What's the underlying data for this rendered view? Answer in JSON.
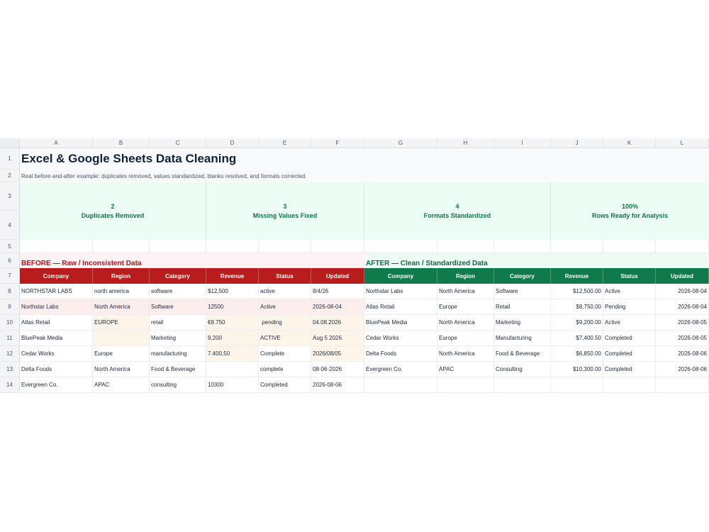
{
  "columns": [
    "A",
    "B",
    "C",
    "D",
    "E",
    "F",
    "G",
    "H",
    "I",
    "J",
    "K",
    "L"
  ],
  "row_numbers": [
    "1",
    "2",
    "3",
    "4",
    "5",
    "6",
    "7",
    "8",
    "9",
    "10",
    "11",
    "12",
    "13",
    "14"
  ],
  "title": "Excel & Google Sheets Data Cleaning",
  "subtitle": "Real before-and-after example: duplicates removed, values standardized, blanks resolved, and formats corrected.",
  "metrics": [
    {
      "value": "2",
      "label": "Duplicates Removed"
    },
    {
      "value": "3",
      "label": "Missing Values Fixed"
    },
    {
      "value": "4",
      "label": "Formats Standardized"
    },
    {
      "value": "100%",
      "label": "Rows Ready for Analysis"
    }
  ],
  "before": {
    "label": "BEFORE — Raw / Inconsistent Data",
    "headers": [
      "Company",
      "Region",
      "Category",
      "Revenue",
      "Status",
      "Updated"
    ],
    "rows": [
      [
        "NORTHSTAR LABS",
        "north america",
        "software",
        "$12,500",
        "active",
        "8/4/26"
      ],
      [
        "Northstar Labs",
        "North America",
        "Software",
        "12500",
        "Active",
        "2026-08-04"
      ],
      [
        "Atlas Retail",
        "EUROPE",
        "retail",
        "€8.750",
        " pending",
        "04.08.2026"
      ],
      [
        "BluePeak Media",
        "",
        "Marketing",
        "9,200",
        "ACTIVE",
        "Aug 5 2026"
      ],
      [
        "Cedar Works",
        "Europe",
        "manufacturing",
        "7.400,50",
        "Complete",
        "2026/08/05"
      ],
      [
        "Delta Foods",
        "North America",
        "Food & Beverage",
        "",
        "complete",
        "08-06-2026"
      ],
      [
        "Evergreen Co.",
        "APAC",
        "consulting",
        "10300",
        "Completed",
        "2026-08-06"
      ]
    ]
  },
  "after": {
    "label": "AFTER — Clean / Standardized Data",
    "headers": [
      "Company",
      "Region",
      "Category",
      "Revenue",
      "Status",
      "Updated"
    ],
    "rows": [
      [
        "Northstar Labs",
        "North America",
        "Software",
        "$12,500.00",
        "Active",
        "2026-08-04"
      ],
      [
        "Atlas Retail",
        "Europe",
        "Retail",
        "$8,750.00",
        "Pending",
        "2026-08-04"
      ],
      [
        "BluePeak Media",
        "North America",
        "Marketing",
        "$9,200.00",
        "Active",
        "2026-08-05"
      ],
      [
        "Cedar Works",
        "Europe",
        "Manufacturing",
        "$7,400.50",
        "Completed",
        "2026-08-05"
      ],
      [
        "Delta Foods",
        "North America",
        "Food & Beverage",
        "$6,850.00",
        "Completed",
        "2026-08-06"
      ],
      [
        "Evergreen Co.",
        "APAC",
        "Consulting",
        "$10,300.00",
        "Completed",
        "2026-08-06"
      ]
    ]
  },
  "colors": {
    "before_header": "#b91c1c",
    "after_header": "#117a4c",
    "metric_bg": "#ecfdf5",
    "metric_text": "#17714b",
    "highlight_pink": "#fdeeee",
    "highlight_peach": "#fef5ea"
  }
}
